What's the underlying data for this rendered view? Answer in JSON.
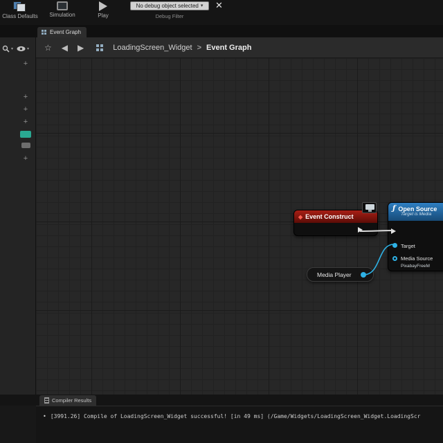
{
  "toolbar": {
    "class_defaults_label": "Class Defaults",
    "simulation_label": "Simulation",
    "play_label": "Play",
    "debug_dropdown_value": "No debug object selected",
    "debug_filter_label": "Debug Filter"
  },
  "tab_bar": {
    "event_graph_tab": "Event Graph"
  },
  "graph_toolbar": {
    "breadcrumb_root": "LoadingScreen_Widget",
    "breadcrumb_separator": ">",
    "breadcrumb_current": "Event Graph"
  },
  "nodes": {
    "event_construct": {
      "title": "Event Construct"
    },
    "open_source": {
      "title": "Open Source",
      "subtitle": "Target is Media",
      "target_pin_label": "Target",
      "media_source_pin_label": "Media Source",
      "media_source_value": "PixabayFreeM"
    },
    "media_player": {
      "title": "Media Player"
    }
  },
  "compiler": {
    "tab_label": "Compiler Results",
    "log_line": "[3991.26] Compile of LoadingScreen_Widget successful! [in 49 ms] (/Game/Widgets/LoadingScreen_Widget.LoadingScr"
  },
  "icons": {
    "star": "☆",
    "back": "◀",
    "forward": "▶",
    "close": "✕",
    "plus": "+",
    "caret_down": "▾",
    "bullet": "•",
    "diamond": "◆",
    "fn": "ƒ"
  },
  "colors": {
    "event_node_header": "#a81e15",
    "function_node_header": "#2e7fc2",
    "object_pin_cyan": "#2eb2e6",
    "graph_background": "#272727"
  }
}
